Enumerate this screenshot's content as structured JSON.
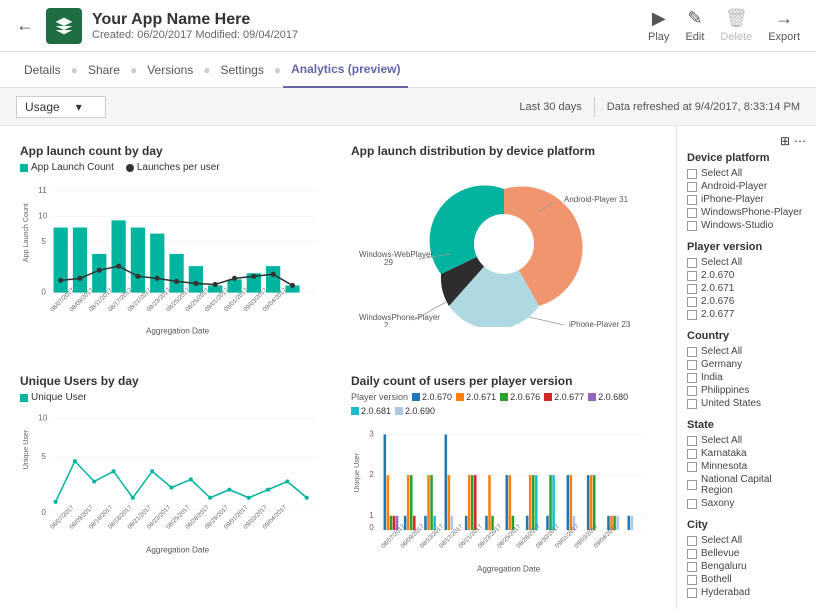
{
  "header": {
    "back_label": "←",
    "app_name": "Your App Name Here",
    "app_meta": "Created: 06/20/2017    Modified: 09/04/2017",
    "actions": [
      {
        "label": "Play",
        "icon": "▷",
        "disabled": false
      },
      {
        "label": "Edit",
        "icon": "✎",
        "disabled": false
      },
      {
        "label": "Delete",
        "icon": "🗑",
        "disabled": true
      },
      {
        "label": "Export",
        "icon": "→",
        "disabled": false
      }
    ]
  },
  "nav": {
    "tabs": [
      "Details",
      "Share",
      "Versions",
      "Settings",
      "Analytics (preview)"
    ],
    "active": "Analytics (preview)"
  },
  "toolbar": {
    "select_label": "Usage",
    "select_arrow": "▾",
    "date_range": "Last 30 days",
    "refresh_info": "Data refreshed at 9/4/2017, 8:33:14 PM"
  },
  "charts": {
    "launch_count": {
      "title": "App launch count by day",
      "legend": [
        {
          "label": "App Launch Count",
          "color": "#00b4a0"
        },
        {
          "label": "Launches per user",
          "color": "#333"
        }
      ]
    },
    "distribution": {
      "title": "App launch distribution by device platform",
      "segments": [
        {
          "label": "Android-Player 31",
          "color": "#f0956e",
          "value": 31
        },
        {
          "label": "iPhone-Player 23",
          "color": "#b0d8e0",
          "value": 23
        },
        {
          "label": "WindowsPhone-Player 2",
          "color": "#2d2d2d",
          "value": 2
        },
        {
          "label": "Windows-WebPlayer 29",
          "color": "#00b4a0",
          "value": 29
        }
      ]
    },
    "unique_users": {
      "title": "Unique Users by day",
      "legend": [
        {
          "label": "Unique User",
          "color": "#00b4a0"
        }
      ]
    },
    "daily_count": {
      "title": "Daily count of users per player version",
      "player_label": "Player version",
      "versions": [
        {
          "label": "2.0.670",
          "color": "#1f77b4"
        },
        {
          "label": "2.0.671",
          "color": "#ff7f0e"
        },
        {
          "label": "2.0.676",
          "color": "#2ca02c"
        },
        {
          "label": "2.0.677",
          "color": "#d62728"
        },
        {
          "label": "2.0.680",
          "color": "#9467bd"
        },
        {
          "label": "2.0.681",
          "color": "#17becf"
        },
        {
          "label": "2.0.690",
          "color": "#aec7e8"
        }
      ]
    }
  },
  "sidebar": {
    "icons": [
      "⬡",
      "⋯"
    ],
    "sections": [
      {
        "title": "Device platform",
        "items": [
          "Select All",
          "Android-Player",
          "iPhone-Player",
          "WindowsPhone-Player",
          "Windows-Studio"
        ]
      },
      {
        "title": "Player version",
        "items": [
          "Select All",
          "2.0.670",
          "2.0.671",
          "2.0.676",
          "2.0.677"
        ]
      },
      {
        "title": "Country",
        "items": [
          "Select All",
          "Germany",
          "India",
          "Philippines",
          "United States"
        ]
      },
      {
        "title": "State",
        "items": [
          "Select All",
          "Karnataka",
          "Minnesota",
          "National Capital Region",
          "Saxony"
        ]
      },
      {
        "title": "City",
        "items": [
          "Select All",
          "Bellevue",
          "Bengaluru",
          "Bothell",
          "Hyderabad"
        ]
      }
    ]
  }
}
